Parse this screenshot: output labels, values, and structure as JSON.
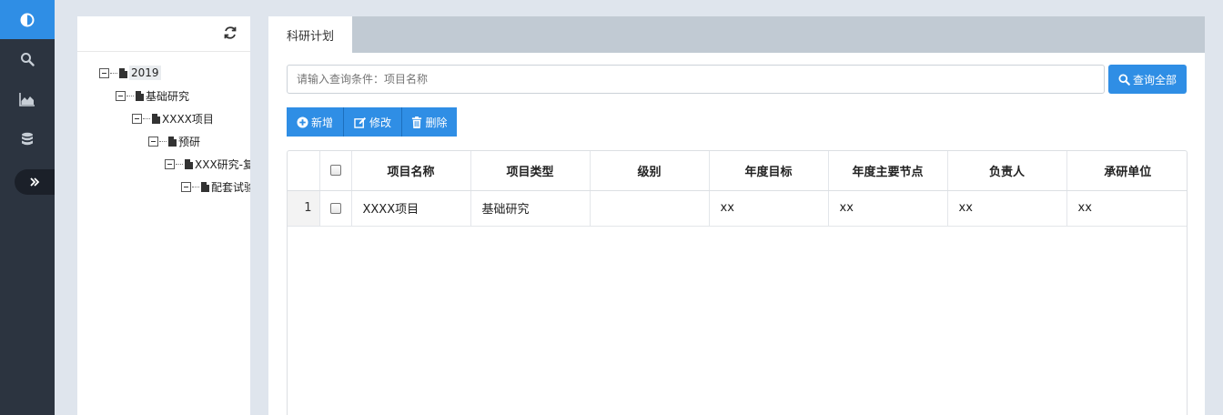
{
  "sidebar": {
    "icons": [
      "contrast-icon",
      "search-icon",
      "area-chart-icon",
      "database-icon",
      "double-chevron-right-icon"
    ],
    "accent": "#2f8ee5",
    "bg": "#2c3440"
  },
  "tree": {
    "nodes": [
      {
        "label": "2019",
        "selected": true
      },
      {
        "label": "基础研究"
      },
      {
        "label": "XXXX项目"
      },
      {
        "label": "预研"
      },
      {
        "label": "XXX研究-复"
      },
      {
        "label": "配套试验"
      }
    ]
  },
  "tabs": [
    {
      "label": "科研计划"
    }
  ],
  "search": {
    "placeholder": "请输入查询条件：项目名称",
    "button_label": "查询全部"
  },
  "toolbar": {
    "add_label": "新增",
    "edit_label": "修改",
    "delete_label": "删除"
  },
  "table": {
    "columns": [
      "项目名称",
      "项目类型",
      "级别",
      "年度目标",
      "年度主要节点",
      "负责人",
      "承研单位"
    ],
    "rows": [
      {
        "index": "1",
        "cells": [
          "XXXX项目",
          "基础研究",
          "",
          "xx",
          "xx",
          "xx",
          "xx"
        ]
      }
    ]
  }
}
